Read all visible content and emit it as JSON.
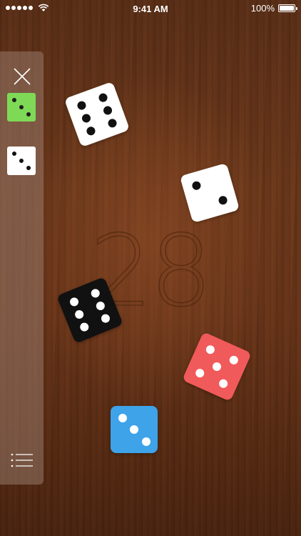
{
  "status_bar": {
    "time": "9:41 AM",
    "battery": "100%",
    "signal_dots": 5,
    "icons": [
      "signal-dots-icon",
      "wifi-icon",
      "battery-icon"
    ]
  },
  "sidebar": {
    "close_icon": "close-icon",
    "menu_icon": "list-menu-icon",
    "dice": [
      {
        "name": "green-die-selector",
        "face": 3,
        "color": "#7ed957",
        "pip_color": "#1e1e1e"
      },
      {
        "name": "white-die-selector",
        "face": 3,
        "color": "#ffffff",
        "pip_color": "#111111"
      }
    ]
  },
  "score": "28",
  "dice": [
    {
      "name": "white-die-six",
      "face": 6,
      "color": "#ffffff",
      "pip_color": "#111111"
    },
    {
      "name": "white-die-two",
      "face": 2,
      "color": "#ffffff",
      "pip_color": "#111111"
    },
    {
      "name": "black-die-six",
      "face": 6,
      "color": "#111111",
      "pip_color": "#ffffff"
    },
    {
      "name": "red-die-five",
      "face": 5,
      "color": "#f05a5a",
      "pip_color": "#ffffff"
    },
    {
      "name": "blue-die-three",
      "face": 3,
      "color": "#3ea3e8",
      "pip_color": "#ffffff"
    }
  ],
  "colors": {
    "table_wood": "#6a3519",
    "sidebar_overlay": "#96786a"
  }
}
